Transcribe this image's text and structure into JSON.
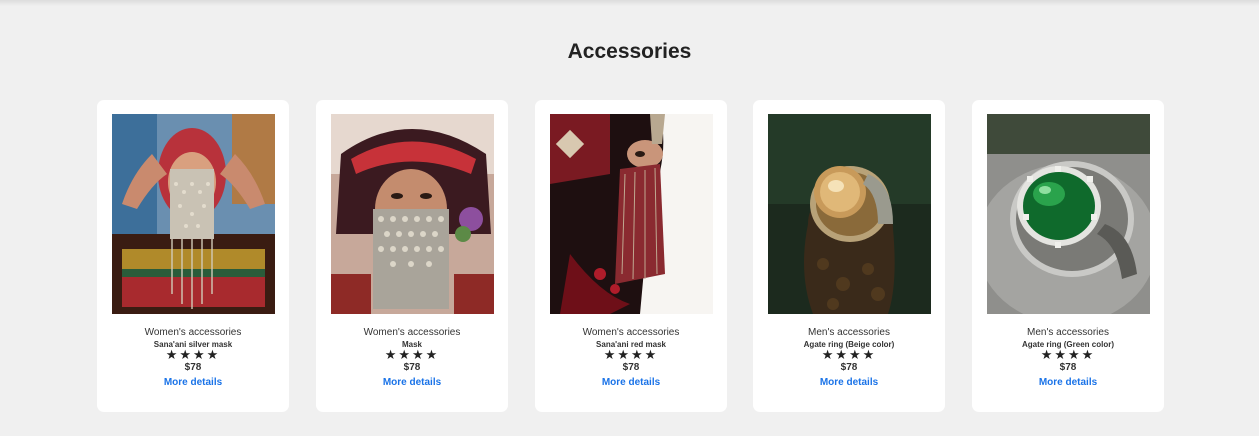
{
  "section": {
    "title": "Accessories"
  },
  "products": [
    {
      "category": "Women's accessories",
      "name": "Sana'ani silver mask",
      "rating_stars": "★★★★",
      "rating": 4,
      "price": "$78",
      "link": "More details",
      "image_icon": "silver-mask-photo"
    },
    {
      "category": "Women's accessories",
      "name": "Mask",
      "rating_stars": "★★★★",
      "rating": 4,
      "price": "$78",
      "link": "More details",
      "image_icon": "mask-photo"
    },
    {
      "category": "Women's accessories",
      "name": "Sana'ani red mask",
      "rating_stars": "★★★★",
      "rating": 4,
      "price": "$78",
      "link": "More details",
      "image_icon": "red-mask-photo"
    },
    {
      "category": "Men's accessories",
      "name": "Agate ring (Beige color)",
      "rating_stars": "★★★★",
      "rating": 4,
      "price": "$78",
      "link": "More details",
      "image_icon": "beige-agate-ring-photo"
    },
    {
      "category": "Men's accessories",
      "name": "Agate ring (Green color)",
      "rating_stars": "★★★★",
      "rating": 4,
      "price": "$78",
      "link": "More details",
      "image_icon": "green-agate-ring-photo"
    }
  ],
  "colors": {
    "background": "#f0f0f0",
    "card": "#ffffff",
    "link": "#1a73e8",
    "text": "#222222"
  }
}
